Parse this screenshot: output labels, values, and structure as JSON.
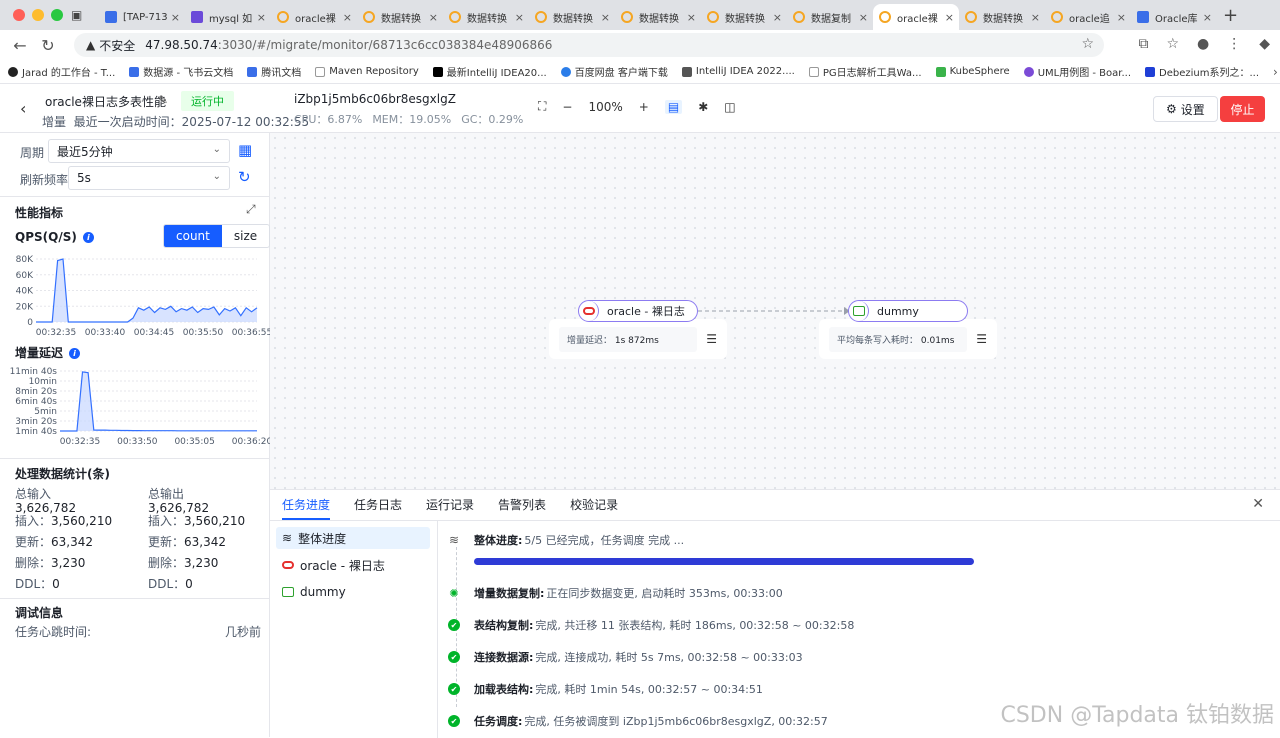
{
  "browser": {
    "tabs": [
      {
        "label": "[TAP-713"
      },
      {
        "label": "mysql 如"
      },
      {
        "label": "oracle裸"
      },
      {
        "label": "数据转换"
      },
      {
        "label": "数据转换"
      },
      {
        "label": "数据转换"
      },
      {
        "label": "数据转换"
      },
      {
        "label": "数据转换"
      },
      {
        "label": "数据复制"
      },
      {
        "label": "oracle裸"
      },
      {
        "label": "数据转换"
      },
      {
        "label": "oracle追"
      },
      {
        "label": "Oracle库"
      }
    ],
    "insecure_label": "不安全",
    "url_host": "47.98.50.74",
    "url_path": ":3030/#/migrate/monitor/68713c6cc038384e48906866",
    "bookmarks": [
      {
        "label": "Jarad 的工作台 - T..."
      },
      {
        "label": "数据源 - 飞书云文档"
      },
      {
        "label": "腾讯文档"
      },
      {
        "label": "Maven Repository"
      },
      {
        "label": "最新IntelliJ IDEA20..."
      },
      {
        "label": "百度网盘 客户端下载"
      },
      {
        "label": "IntelliJ IDEA 2022...."
      },
      {
        "label": "PG日志解析工具Wa..."
      },
      {
        "label": "KubeSphere"
      },
      {
        "label": "UML用例图 - Boar..."
      },
      {
        "label": "Debezium系列之：..."
      }
    ]
  },
  "header": {
    "task_name": "oracle裸日志多表性能",
    "status": "运行中",
    "sync_type": "增量",
    "last_start_label": "最近一次启动时间：",
    "last_start": "2025-07-12 00:32:55",
    "agent_id": "iZbp1j5mb6c06br8esgxlgZ",
    "cpu": "CPU：6.87%",
    "mem": "MEM：19.05%",
    "gc": "GC：0.29%",
    "zoom": "100%",
    "settings_label": "设置",
    "stop_label": "停止"
  },
  "left": {
    "period_label": "周期",
    "period_value": "最近5分钟",
    "refresh_label": "刷新频率",
    "refresh_value": "5s",
    "perf_title": "性能指标",
    "qps_title": "QPS(Q/S)",
    "seg_count": "count",
    "seg_size": "size",
    "lag_title": "增量延迟",
    "stats_title": "处理数据统计(条)",
    "total_in_label": "总输入",
    "total_in": "3,626,782",
    "total_out_label": "总输出",
    "total_out": "3,626,782",
    "insert_label": "插入：",
    "insert_in": "3,560,210",
    "insert_out": "3,560,210",
    "update_label": "更新：",
    "update_in": "63,342",
    "update_out": "63,342",
    "delete_label": "删除：",
    "delete_in": "3,230",
    "delete_out": "3,230",
    "ddl_label": "DDL：",
    "ddl_in": "0",
    "ddl_out": "0",
    "debug_title": "调试信息",
    "heartbeat_label": "任务心跳时间:",
    "heartbeat_value": "几秒前"
  },
  "chart_data": [
    {
      "type": "area",
      "title": "QPS(Q/S)",
      "x_ticks": [
        "00:32:35",
        "00:33:40",
        "00:34:45",
        "00:35:50",
        "00:36:55"
      ],
      "y_ticks": [
        "80K",
        "60K",
        "40K",
        "20K",
        "0"
      ],
      "ylim": [
        0,
        80000
      ],
      "values": [
        0,
        0,
        0,
        0,
        78000,
        80000,
        0,
        0,
        0,
        0,
        0,
        0,
        0,
        0,
        0,
        0,
        0,
        0,
        5000,
        18000,
        15000,
        19000,
        12000,
        18000,
        16000,
        20000,
        13000,
        17000,
        15000,
        19000,
        12000,
        17000,
        16000,
        19000,
        9000,
        17000,
        14000,
        18000,
        8000,
        18000,
        13000,
        18000
      ],
      "color": "#3370ff"
    },
    {
      "type": "area",
      "title": "增量延迟",
      "x_ticks": [
        "00:32:35",
        "00:33:50",
        "00:35:05",
        "00:36:20"
      ],
      "y_ticks": [
        "11min 40s",
        "10min",
        "8min 20s",
        "6min 40s",
        "5min",
        "3min 20s",
        "1min 40s"
      ],
      "ylim_seconds": [
        0,
        700
      ],
      "values": [
        0,
        0,
        0,
        0,
        690,
        680,
        12,
        10,
        10,
        8,
        8,
        6,
        6,
        5,
        5,
        4,
        4,
        3,
        3,
        3,
        3,
        2,
        2,
        2,
        2,
        2,
        2,
        2,
        2,
        2,
        2,
        2,
        2,
        2,
        2,
        2
      ],
      "color": "#3370ff"
    }
  ],
  "canvas": {
    "source_node": "oracle - 裸日志",
    "source_metric": "增量延迟：",
    "source_metric_value": "1s 872ms",
    "target_node": "dummy",
    "target_metric": "平均每条写入耗时：",
    "target_metric_value": "0.01ms"
  },
  "bottom": {
    "tabs": [
      {
        "label": "任务进度"
      },
      {
        "label": "任务日志"
      },
      {
        "label": "运行记录"
      },
      {
        "label": "告警列表"
      },
      {
        "label": "校验记录"
      }
    ],
    "list": [
      {
        "label": "整体进度"
      },
      {
        "label": "oracle - 裸日志"
      },
      {
        "label": "dummy"
      }
    ],
    "steps": [
      {
        "title": "整体进度:",
        "text": "5/5 已经完成，任务调度 完成 ..."
      },
      {
        "title": "增量数据复制:",
        "text": "正在同步数据变更, 启动耗时 353ms, 00:33:00"
      },
      {
        "title": "表结构复制:",
        "text": "完成, 共迁移 11 张表结构, 耗时 186ms, 00:32:58 ~ 00:32:58"
      },
      {
        "title": "连接数据源:",
        "text": "完成, 连接成功, 耗时 5s 7ms, 00:32:58 ~ 00:33:03"
      },
      {
        "title": "加载表结构:",
        "text": "完成, 耗时 1min 54s, 00:32:57 ~ 00:34:51"
      },
      {
        "title": "任务调度:",
        "text": "完成, 任务被调度到 iZbp1j5mb6c06br8esgxlgZ, 00:32:57"
      }
    ],
    "progress_fraction": 1.0
  },
  "watermark": "CSDN @Tapdata 钛铂数据"
}
